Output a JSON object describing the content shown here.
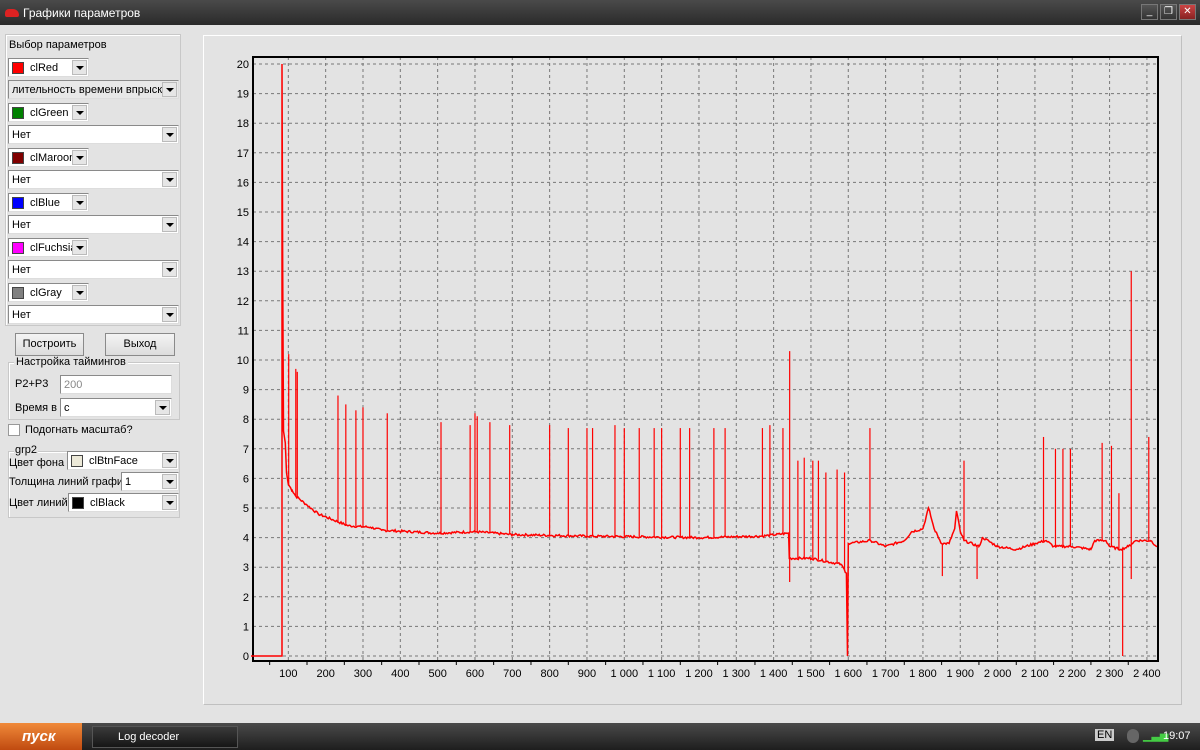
{
  "window": {
    "title": "Графики параметров",
    "buttons": [
      "_",
      "❐",
      "✕"
    ]
  },
  "params": {
    "group_label": "Выбор параметров",
    "rows": [
      {
        "color_name": "clRed",
        "color": "#ff0000",
        "param": "лительность времени впрыска"
      },
      {
        "color_name": "clGreen",
        "color": "#008000",
        "param": "Нет"
      },
      {
        "color_name": "clMaroon",
        "color": "#800000",
        "param": "Нет"
      },
      {
        "color_name": "clBlue",
        "color": "#0000ff",
        "param": "Нет"
      },
      {
        "color_name": "clFuchsia",
        "color": "#ff00ff",
        "param": "Нет"
      },
      {
        "color_name": "clGray",
        "color": "#808080",
        "param": "Нет"
      }
    ]
  },
  "buttons": {
    "build": "Построить",
    "exit": "Выход"
  },
  "timing": {
    "group_label": "Настройка таймингов",
    "p2p3_label": "P2+P3",
    "p2p3_value": "200",
    "time_label": "Время в",
    "time_value": "с"
  },
  "fit_scale": {
    "label": "Подогнать масштаб?",
    "checked": false
  },
  "grp2": {
    "group_label": "grp2",
    "bg_label": "Цвет фона",
    "bg_value": "clBtnFace",
    "bg_color": "#ece9d8",
    "width_label": "Толщина линий график",
    "width_value": "1",
    "line_label": "Цвет линий",
    "line_value": "clBlack",
    "line_color": "#000000"
  },
  "chart_data": {
    "type": "line",
    "title": "",
    "xlabel": "",
    "ylabel": "",
    "xlim": [
      0,
      2427
    ],
    "ylim": [
      0,
      20
    ],
    "grid": true,
    "x_ticks": [
      100,
      200,
      300,
      400,
      500,
      600,
      700,
      800,
      900,
      1000,
      1100,
      1200,
      1300,
      1400,
      1500,
      1600,
      1700,
      1800,
      1900,
      2000,
      2100,
      2200,
      2300,
      2400
    ],
    "x_tick_labels": [
      "100",
      "200",
      "300",
      "400",
      "500",
      "600",
      "700",
      "800",
      "900",
      "1 000",
      "1 100",
      "1 200",
      "1 300",
      "1 400",
      "1 500",
      "1 600",
      "1 700",
      "1 800",
      "1 900",
      "2 000",
      "2 100",
      "2 200",
      "2 300",
      "2 400"
    ],
    "y_ticks": [
      0,
      1,
      2,
      3,
      4,
      5,
      6,
      7,
      8,
      9,
      10,
      11,
      12,
      13,
      14,
      15,
      16,
      17,
      18,
      19,
      20
    ],
    "series": [
      {
        "name": "лительность времени впрыска",
        "color": "#ff0000",
        "baseline": [
          [
            0,
            0
          ],
          [
            83,
            0
          ],
          [
            83,
            20
          ],
          [
            85,
            13
          ],
          [
            87,
            7.6
          ],
          [
            92,
            7.2
          ],
          [
            95,
            6.2
          ],
          [
            100,
            5.8
          ],
          [
            110,
            5.6
          ],
          [
            120,
            5.4
          ],
          [
            150,
            5.1
          ],
          [
            180,
            4.8
          ],
          [
            220,
            4.6
          ],
          [
            260,
            4.4
          ],
          [
            320,
            4.35
          ],
          [
            350,
            4.25
          ],
          [
            500,
            4.15
          ],
          [
            600,
            4.2
          ],
          [
            700,
            4.1
          ],
          [
            900,
            4.05
          ],
          [
            1200,
            4.0
          ],
          [
            1370,
            4.05
          ],
          [
            1440,
            4.15
          ],
          [
            1442,
            3.3
          ],
          [
            1500,
            3.3
          ],
          [
            1580,
            3.1
          ],
          [
            1595,
            2.8
          ],
          [
            1598,
            0
          ],
          [
            1600,
            3.8
          ],
          [
            1660,
            3.9
          ],
          [
            1700,
            3.7
          ],
          [
            1750,
            3.9
          ],
          [
            1770,
            4.2
          ],
          [
            1800,
            4.3
          ],
          [
            1815,
            5.0
          ],
          [
            1830,
            4.3
          ],
          [
            1850,
            3.8
          ],
          [
            1870,
            3.8
          ],
          [
            1885,
            4.3
          ],
          [
            1890,
            4.9
          ],
          [
            1900,
            4.2
          ],
          [
            1910,
            3.9
          ],
          [
            1950,
            3.7
          ],
          [
            1960,
            4.0
          ],
          [
            2000,
            3.7
          ],
          [
            2050,
            3.6
          ],
          [
            2100,
            3.8
          ],
          [
            2130,
            3.9
          ],
          [
            2150,
            3.7
          ],
          [
            2200,
            3.7
          ],
          [
            2250,
            3.6
          ],
          [
            2260,
            3.9
          ],
          [
            2290,
            3.9
          ],
          [
            2300,
            3.7
          ],
          [
            2330,
            3.6
          ],
          [
            2350,
            3.7
          ],
          [
            2370,
            3.9
          ],
          [
            2410,
            3.9
          ],
          [
            2427,
            3.7
          ]
        ],
        "spikes": [
          [
            101,
            10.2
          ],
          [
            120,
            9.7
          ],
          [
            124,
            9.6
          ],
          [
            233,
            8.8
          ],
          [
            254,
            8.5
          ],
          [
            281,
            8.3
          ],
          [
            300,
            8.4
          ],
          [
            365,
            8.2
          ],
          [
            509,
            7.9
          ],
          [
            587,
            7.8
          ],
          [
            600,
            8.2
          ],
          [
            606,
            8.1
          ],
          [
            640,
            7.9
          ],
          [
            693,
            7.8
          ],
          [
            800,
            7.8
          ],
          [
            850,
            7.7
          ],
          [
            900,
            7.7
          ],
          [
            915,
            7.7
          ],
          [
            975,
            7.8
          ],
          [
            1000,
            7.7
          ],
          [
            1040,
            7.7
          ],
          [
            1080,
            7.7
          ],
          [
            1100,
            7.7
          ],
          [
            1150,
            7.7
          ],
          [
            1175,
            7.7
          ],
          [
            1240,
            7.7
          ],
          [
            1270,
            7.7
          ],
          [
            1370,
            7.7
          ],
          [
            1390,
            7.8
          ],
          [
            1425,
            7.7
          ],
          [
            1443,
            10.3
          ],
          [
            1465,
            6.6
          ],
          [
            1482,
            6.7
          ],
          [
            1505,
            6.6
          ],
          [
            1520,
            6.6
          ],
          [
            1540,
            6.2
          ],
          [
            1570,
            6.3
          ],
          [
            1590,
            6.2
          ],
          [
            1658,
            7.7
          ],
          [
            1910,
            6.6
          ],
          [
            2123,
            7.4
          ],
          [
            2155,
            7.0
          ],
          [
            2175,
            7.0
          ],
          [
            2195,
            7.0
          ],
          [
            2280,
            7.2
          ],
          [
            2305,
            7.1
          ],
          [
            2325,
            5.5
          ],
          [
            2358,
            13.0
          ],
          [
            2405,
            7.4
          ],
          [
            1443,
            2.5
          ],
          [
            1852,
            2.7
          ],
          [
            1945,
            2.6
          ],
          [
            2335,
            0
          ],
          [
            2358,
            2.6
          ]
        ]
      }
    ]
  },
  "taskbar": {
    "start": "пуск",
    "task": "Log decoder",
    "lang": "EN",
    "clock": "19:07"
  }
}
